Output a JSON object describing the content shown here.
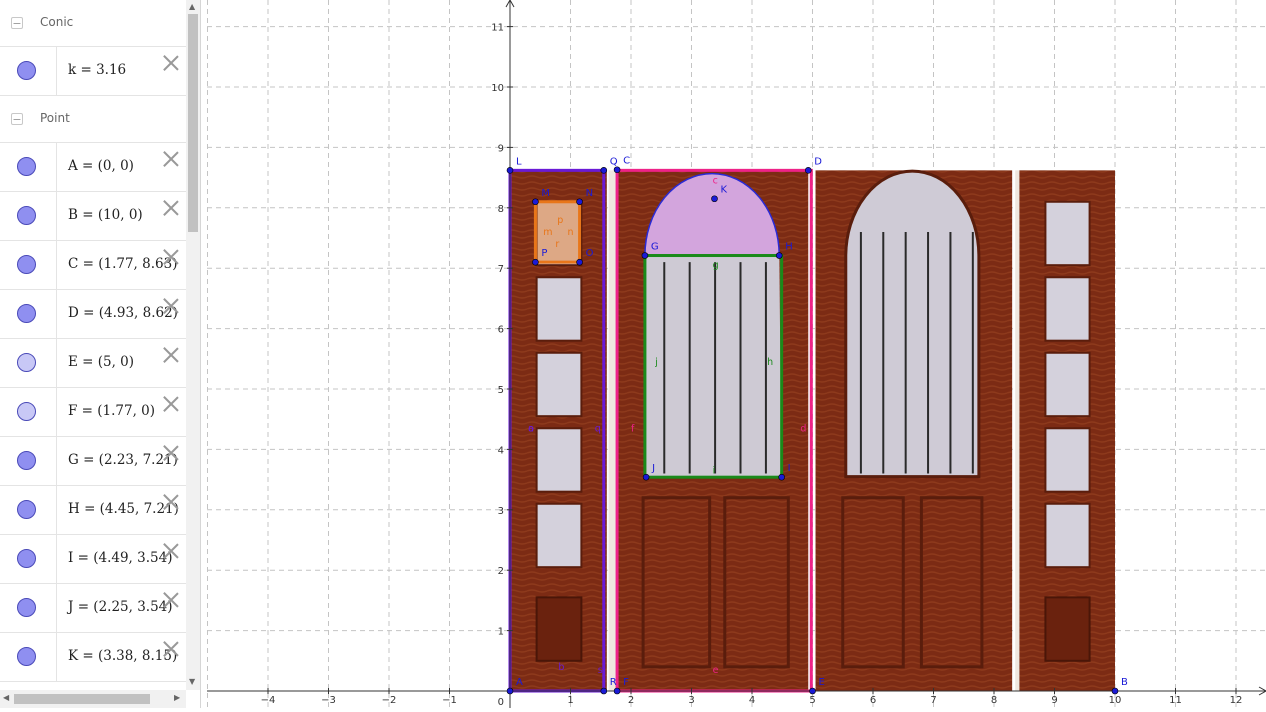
{
  "algebra": {
    "groups": [
      {
        "label": "Conic",
        "items": [
          {
            "expr": "k = 3.16",
            "shade": "dark"
          }
        ]
      },
      {
        "label": "Point",
        "items": [
          {
            "expr": "A = (0, 0)",
            "shade": "dark"
          },
          {
            "expr": "B = (10, 0)",
            "shade": "dark"
          },
          {
            "expr": "C = (1.77, 8.63)",
            "shade": "dark"
          },
          {
            "expr": "D = (4.93, 8.62)",
            "shade": "dark"
          },
          {
            "expr": "E = (5, 0)",
            "shade": "light"
          },
          {
            "expr": "F = (1.77, 0)",
            "shade": "light"
          },
          {
            "expr": "G = (2.23, 7.21)",
            "shade": "dark"
          },
          {
            "expr": "H = (4.45, 7.21)",
            "shade": "dark"
          },
          {
            "expr": "I = (4.49, 3.54)",
            "shade": "dark"
          },
          {
            "expr": "J = (2.25, 3.54)",
            "shade": "dark"
          },
          {
            "expr": "K = (3.38, 8.15)",
            "shade": "dark"
          }
        ]
      }
    ]
  },
  "graphics": {
    "x_ticks": [
      "−4",
      "−3",
      "−2",
      "−1",
      "1",
      "2",
      "3",
      "4",
      "5",
      "6",
      "7",
      "8",
      "9",
      "10",
      "11",
      "12"
    ],
    "y_ticks": [
      "1",
      "2",
      "3",
      "4",
      "5",
      "6",
      "7",
      "8",
      "9",
      "10",
      "11"
    ],
    "origin_label": "0",
    "point_labels": [
      "A",
      "B",
      "C",
      "D",
      "E",
      "F",
      "G",
      "H",
      "I",
      "J",
      "K",
      "L",
      "M",
      "N",
      "O",
      "P",
      "Q",
      "R"
    ],
    "segment_labels": [
      "a",
      "b",
      "c",
      "d",
      "e",
      "f",
      "g",
      "h",
      "i",
      "j",
      "q",
      "r",
      "p",
      "m",
      "n",
      "o",
      "s"
    ],
    "colors": {
      "blue_points": "#1a1ad6",
      "pink": "#ee2288",
      "green": "#1a8a1a",
      "purple": "#6a1ad6",
      "orange": "#e8761a",
      "wood": "#7a2a12",
      "wood_light": "#9a3a1e"
    }
  }
}
